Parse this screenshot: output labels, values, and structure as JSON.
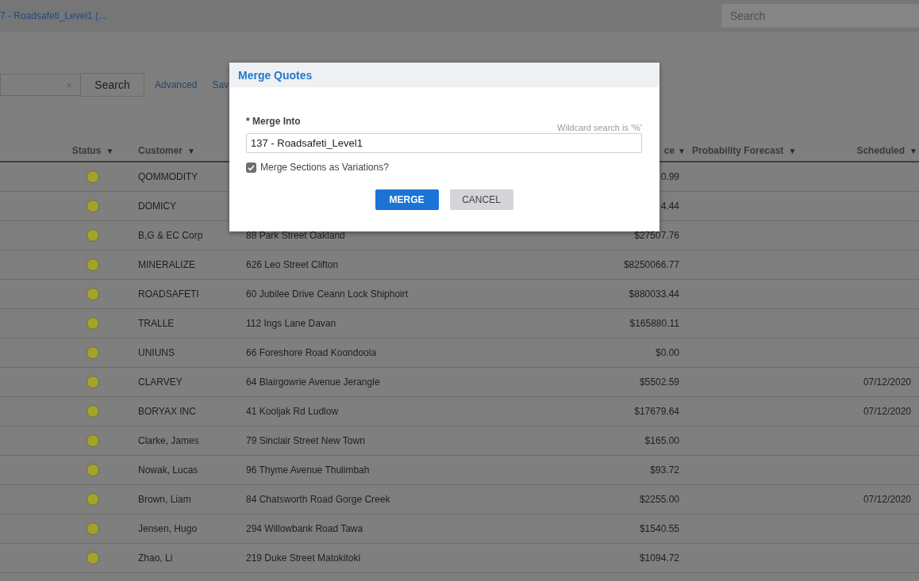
{
  "topbar": {
    "breadcrumb": "7 - Roadsafeti_Level1 (...",
    "search": {
      "placeholder": "Search"
    }
  },
  "toolbar": {
    "search_button": "Search",
    "clear": "×",
    "links": [
      "Advanced",
      "Sav"
    ]
  },
  "table": {
    "columns": [
      {
        "label": "Status",
        "arrow": "▼"
      },
      {
        "label": "Customer",
        "arrow": "▼"
      },
      {},
      {
        "label": "ce",
        "arrow": "▼"
      },
      {
        "label": "Probability Forecast",
        "arrow": "▼"
      },
      {
        "label": "Scheduled",
        "arrow": "▼"
      }
    ],
    "rows": [
      {
        "color": "#a3a32c",
        "customer": "QOMMODITY",
        "price": "0.99"
      },
      {
        "color": "#a3a32c",
        "customer": "DOMICY",
        "price": "4.44"
      },
      {
        "color": "#a3a32c",
        "customer": "B,G & EC Corp",
        "address": "88 Park Street Oakland",
        "price": "$27507.76"
      },
      {
        "color": "#a3a32c",
        "customer": "MINERALIZE",
        "address": "626 Leo Street Clifton",
        "price": "$8250066.77"
      },
      {
        "color": "#a3a32c",
        "customer": "ROADSAFETI",
        "address": "60 Jubilee Drive Ceann Lock Shiphoirt",
        "price": "$880033.44"
      },
      {
        "color": "#a3a32c",
        "customer": "TRALLE",
        "address": "112 Ings Lane Davan",
        "price": "$165880.11"
      },
      {
        "color": "#a3a32c",
        "customer": "UNIUNS",
        "address": "66 Foreshore Road Koondoola",
        "price": "$0.00"
      },
      {
        "color": "#a3a32c",
        "customer": "CLARVEY",
        "address": "64 Blairgowrie Avenue Jerangle",
        "price": "$5502.59",
        "scheduled": "07/12/2020"
      },
      {
        "color": "#a3a32c",
        "customer": "BORYAX INC",
        "address": "41 Kooljak Rd Ludlow",
        "price": "$17679.64",
        "scheduled": "07/12/2020"
      },
      {
        "color": "#a3a32c",
        "customer": "Clarke, James",
        "address": "79 Sinclair Street New Town",
        "price": "$165.00"
      },
      {
        "color": "#a3a32c",
        "customer": "Nowak, Lucas",
        "address": "96 Thyme Avenue Thulimbah",
        "price": "$93.72"
      },
      {
        "color": "#a3a32c",
        "customer": "Brown, Liam",
        "address": "84 Chatsworth Road Gorge Creek",
        "price": "$2255.00",
        "scheduled": "07/12/2020"
      },
      {
        "color": "#a3a32c",
        "customer": "Jensen, Hugo",
        "address": "294 Willowbank Road Tawa",
        "price": "$1540.55"
      },
      {
        "color": "#a3a32c",
        "customer": "Zhao, Li",
        "address": "219 Duke Street Matokitoki",
        "price": "$1094.72"
      }
    ]
  },
  "dialog": {
    "title": "Merge Quotes",
    "field_label": "* Merge Into",
    "hint": "Wildcard search is '%'",
    "value": "137 - Roadsafeti_Level1",
    "checkbox": {
      "label": "Merge Sections as Variations?",
      "checked": true
    },
    "buttons": [
      {
        "label": "MERGE",
        "kind": "primary"
      },
      {
        "label": "CANCEL",
        "kind": "secondary"
      }
    ]
  }
}
